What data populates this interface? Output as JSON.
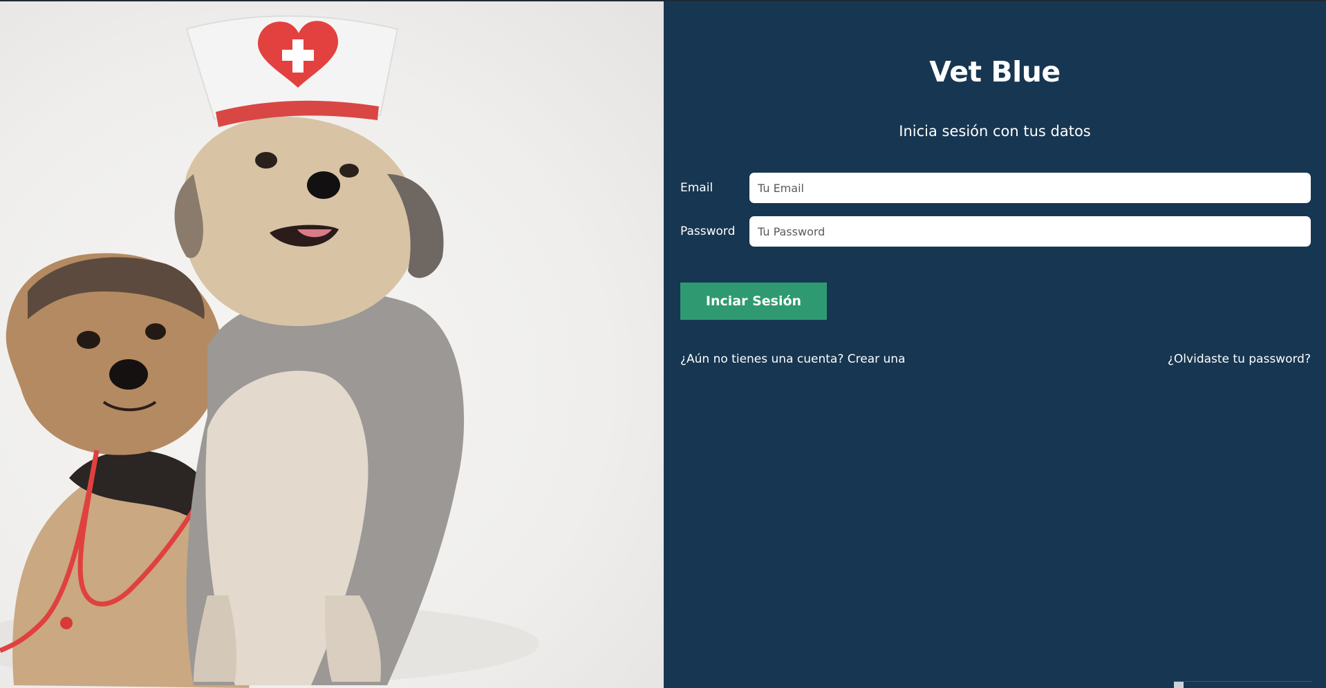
{
  "brand": {
    "title": "Vet Blue",
    "subtitle": "Inicia sesión con tus datos"
  },
  "form": {
    "email": {
      "label": "Email",
      "placeholder": "Tu Email",
      "value": ""
    },
    "password": {
      "label": "Password",
      "placeholder": "Tu Password",
      "value": ""
    },
    "submit_label": "Inciar Sesión"
  },
  "links": {
    "create_account": "¿Aún no tienes una cuenta? Crear una",
    "forgot_password": "¿Olvidaste tu password?"
  },
  "colors": {
    "panel_background": "#173651",
    "button_background": "#2f9a72",
    "text": "#ffffff"
  },
  "hero_image": {
    "icon": "two-dogs-nurse-hat-photo"
  }
}
